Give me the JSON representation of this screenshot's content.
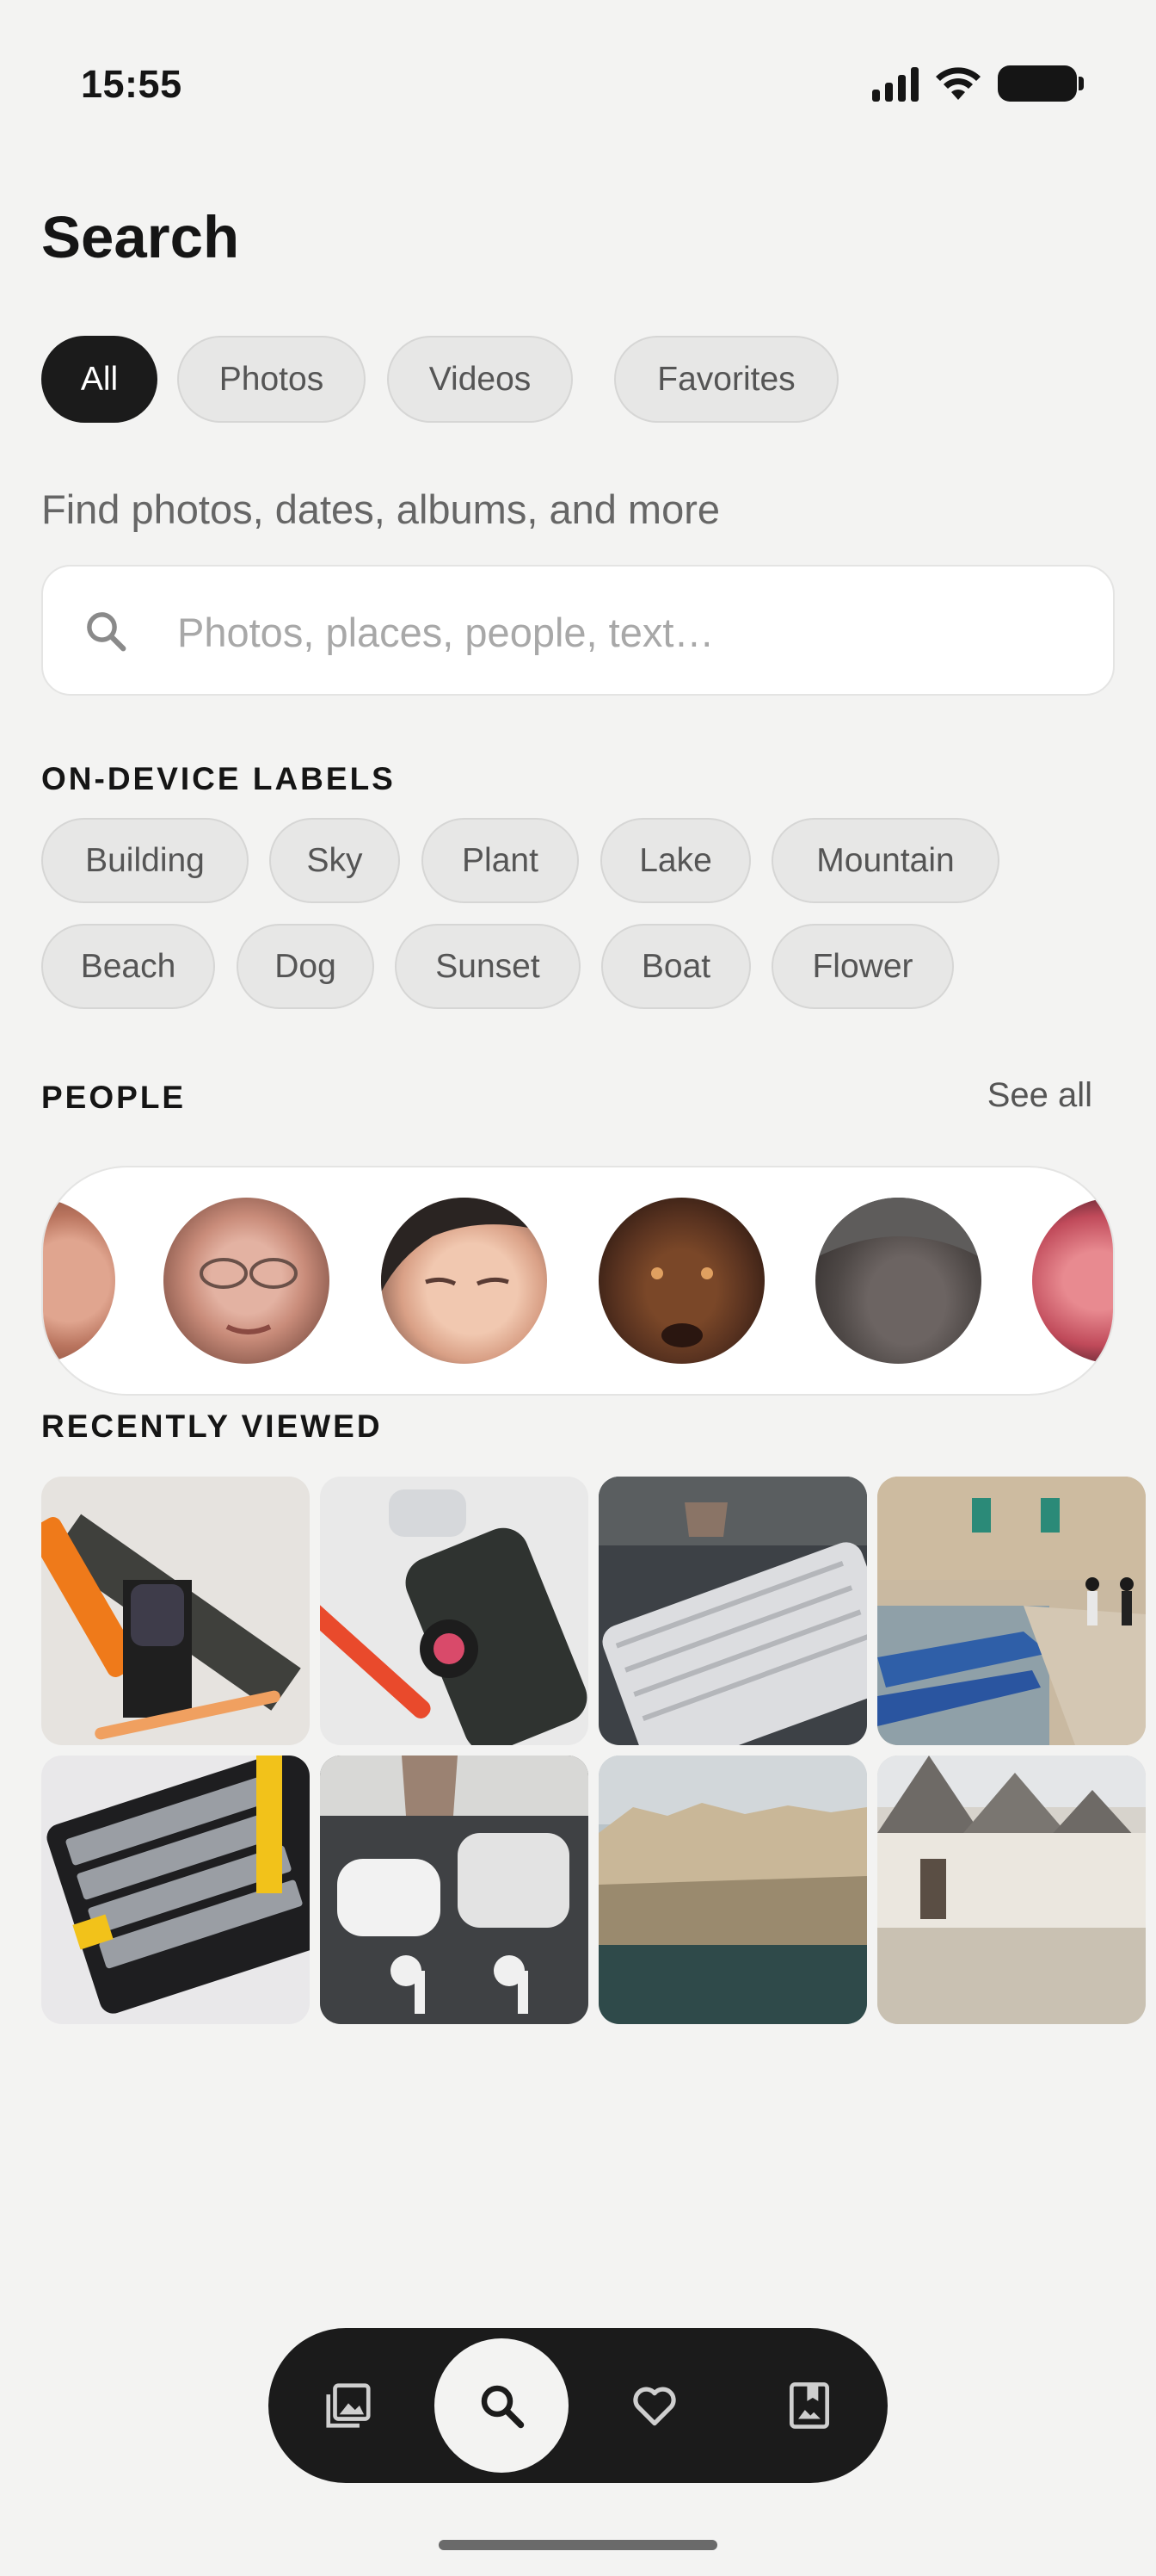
{
  "status_bar": {
    "time": "15:55"
  },
  "page": {
    "title": "Search"
  },
  "filters": [
    {
      "label": "All",
      "active": true
    },
    {
      "label": "Photos",
      "active": false
    },
    {
      "label": "Videos",
      "active": false
    },
    {
      "label": "Favorites",
      "active": false
    }
  ],
  "search": {
    "hint": "Find photos, dates, albums, and more",
    "placeholder": "Photos, places, people, text…",
    "value": ""
  },
  "labels_section": {
    "title": "ON-DEVICE LABELS",
    "items": [
      "Building",
      "Sky",
      "Plant",
      "Lake",
      "Mountain",
      "Beach",
      "Dog",
      "Sunset",
      "Boat",
      "Flower"
    ]
  },
  "people_section": {
    "title": "PEOPLE",
    "see_all": "See all",
    "faces": [
      "person-face",
      "person-face",
      "person-face",
      "dog-face",
      "person-face",
      "person-face"
    ]
  },
  "recent_section": {
    "title": "RECENTLY VIEWED",
    "photos": [
      "watch-and-bands-photo",
      "phone-and-watch-photo",
      "keyboard-photo",
      "harbor-boats-photo",
      "mechanical-keyboard-photo",
      "earbuds-photo",
      "cliff-town-photo",
      "trulli-street-photo"
    ]
  },
  "bottom_nav": {
    "items": [
      "photos-icon",
      "search-icon",
      "heart-icon",
      "album-icon"
    ],
    "active": "search-icon"
  },
  "colors": {
    "background": "#f3f3f2",
    "active_chip": "#1b1b1b",
    "chip": "#e7e7e6",
    "nav": "#1b1b1b"
  }
}
